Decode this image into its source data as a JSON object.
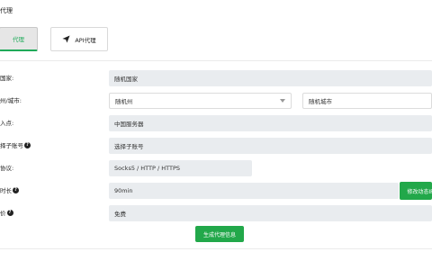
{
  "page_title": "代理",
  "tabs": {
    "dynamic_label": "代理",
    "api_label": "API代理"
  },
  "form": {
    "country_label": "国家:",
    "country_value": "随机国家",
    "region_label": "州/城市:",
    "state_value": "随机州",
    "city_value": "随机城市",
    "access_label": "入点:",
    "access_value": "中国服务器",
    "subaccount_label": "择子账号",
    "subaccount_value": "选择子账号",
    "protocol_label": "协议:",
    "protocol_value": "Socks5 / HTTP / HTTPS",
    "duration_label": "时长",
    "duration_value": "90min",
    "duration_button": "修改动态IP",
    "price_label": "价",
    "price_value": "免费",
    "generate_button": "生成代理信息"
  },
  "icons": {
    "api_tab_icon": "paper-plane-icon",
    "help_icon": "question-circle-icon",
    "select_caret": "chevron-down-icon"
  },
  "colors": {
    "accent": "#1faa59",
    "button_green": "#22a84a",
    "field_bg": "#e9ecef"
  }
}
